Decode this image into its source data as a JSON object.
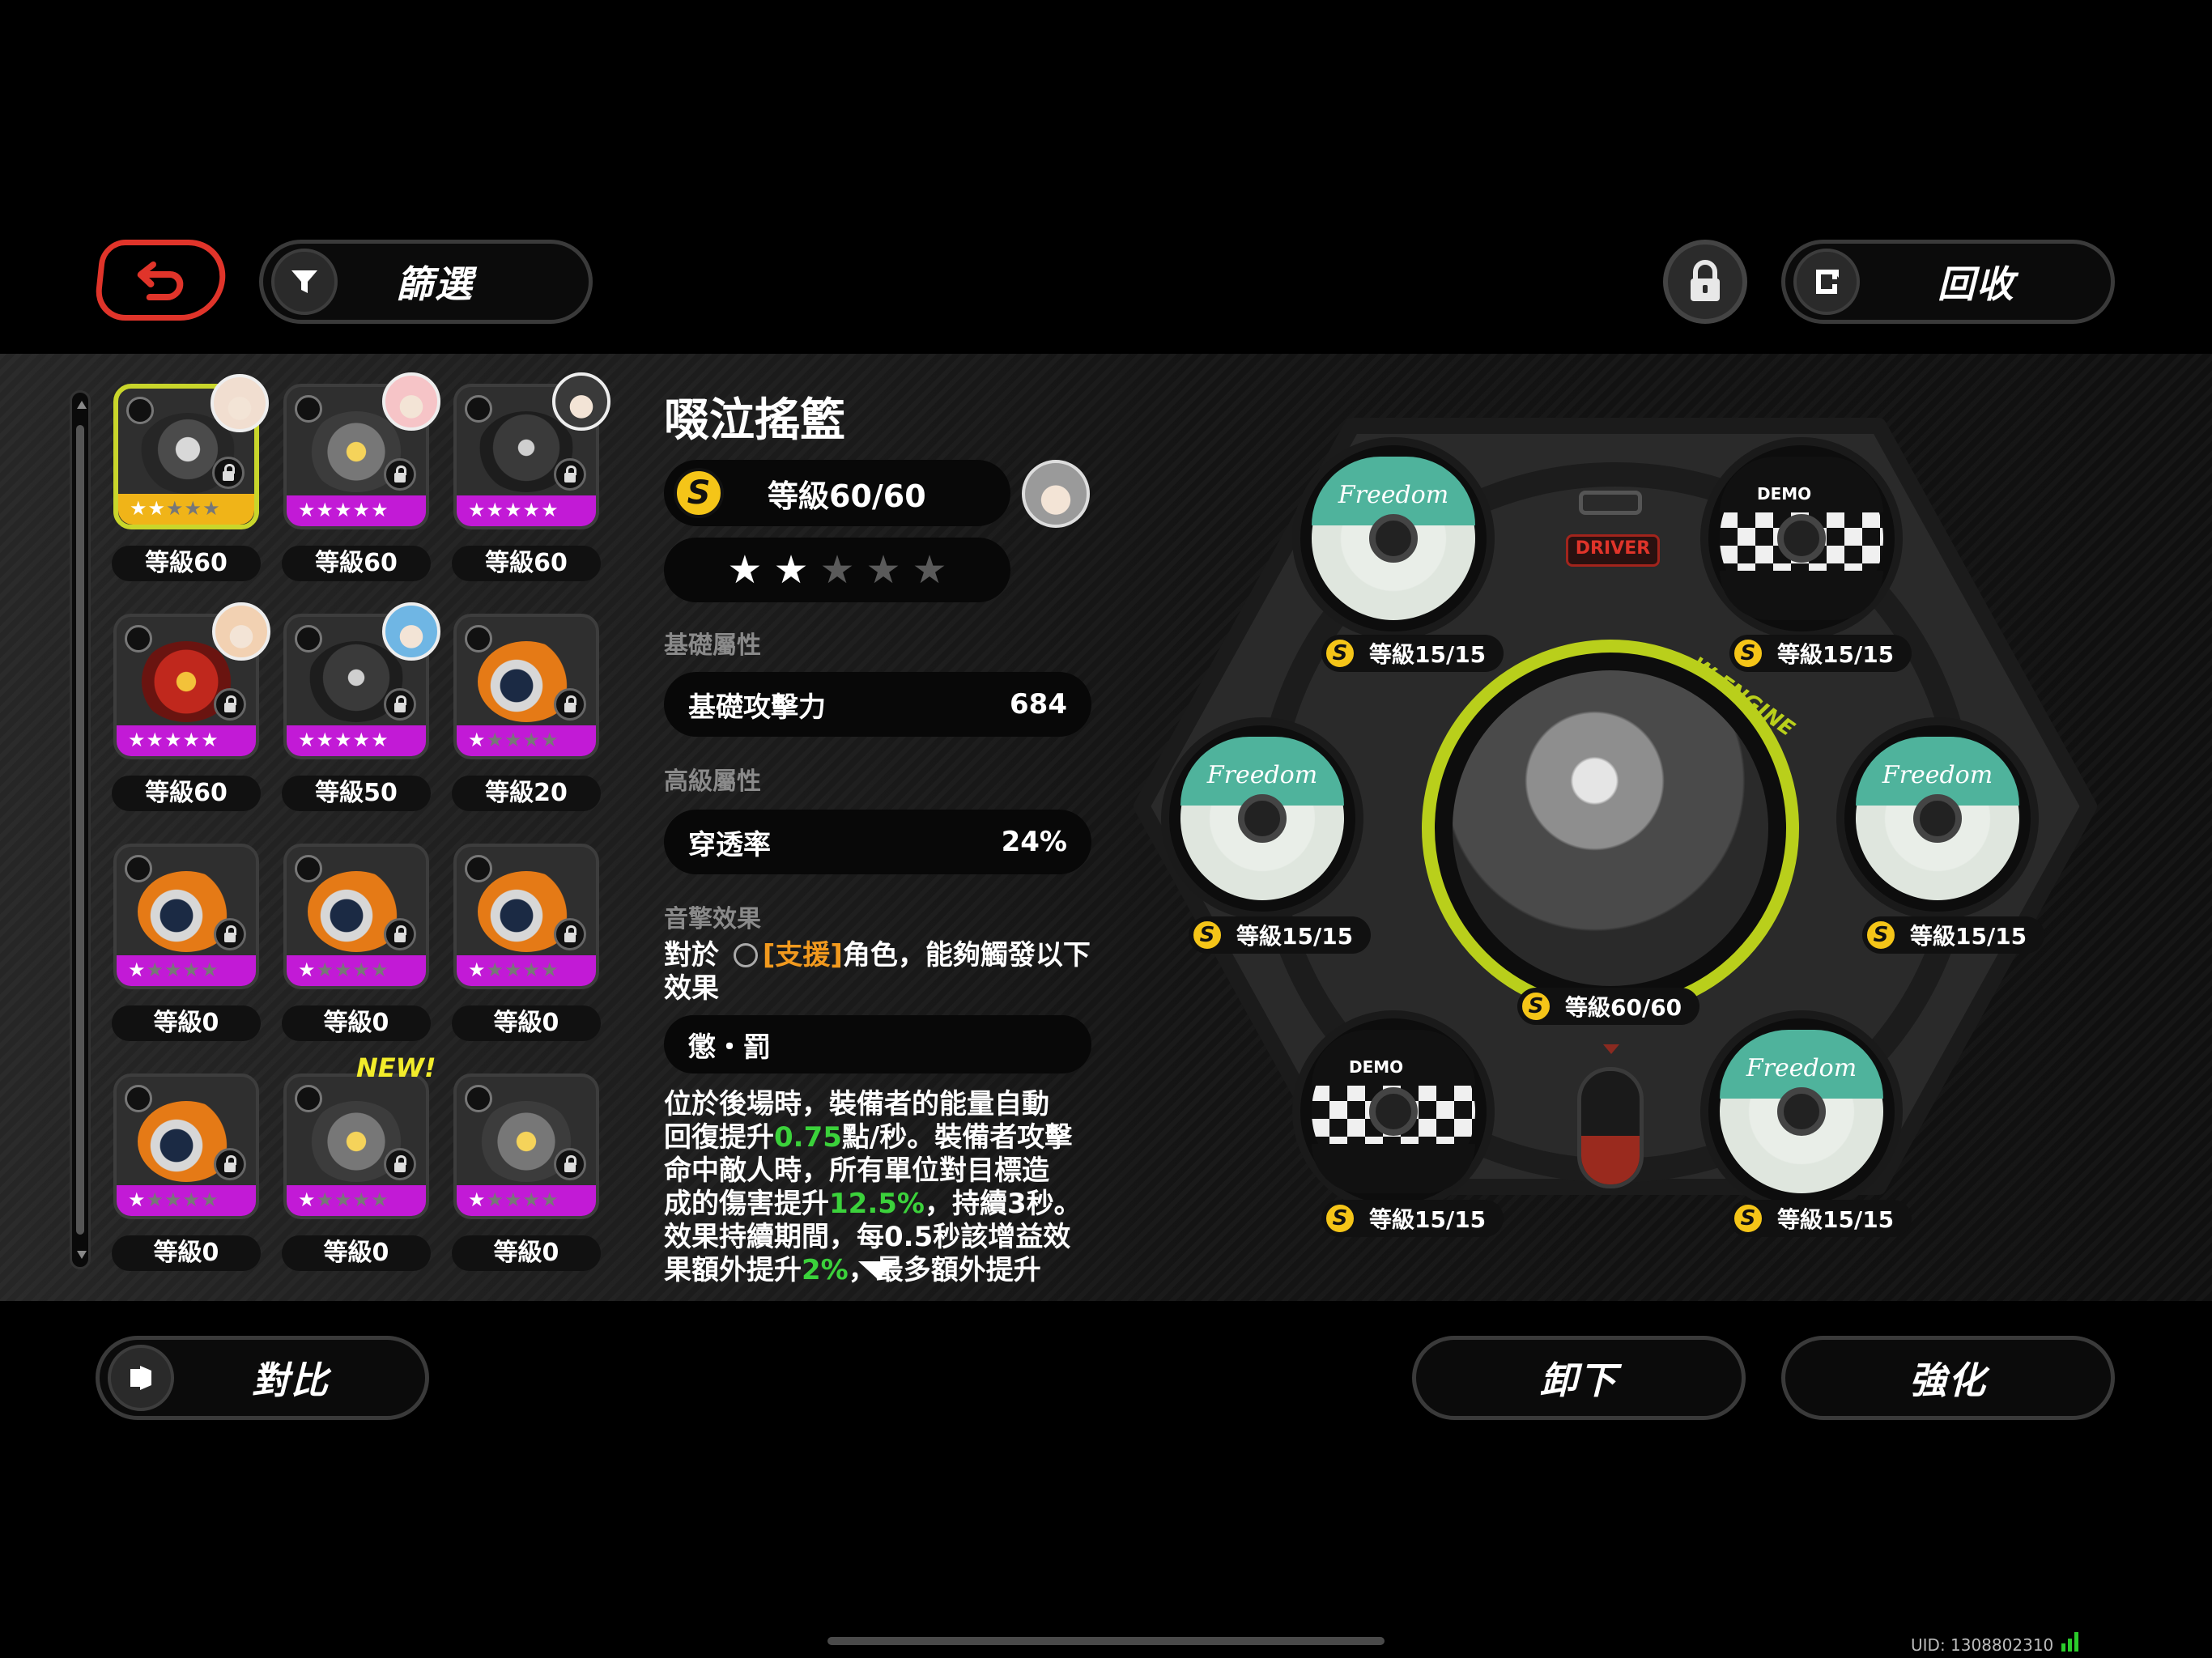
{
  "header": {
    "filter_label": "篩選",
    "recycle_label": "回收"
  },
  "footer": {
    "compare_label": "對比",
    "unequip_label": "卸下",
    "upgrade_label": "強化"
  },
  "grid": {
    "items": [
      {
        "level": "等級60",
        "stars": 2,
        "selected": true
      },
      {
        "level": "等級60",
        "stars": 5
      },
      {
        "level": "等級60",
        "stars": 5
      },
      {
        "level": "等級60",
        "stars": 5
      },
      {
        "level": "等級50",
        "stars": 5
      },
      {
        "level": "等級20",
        "stars": 1
      },
      {
        "level": "等級0",
        "stars": 1
      },
      {
        "level": "等級0",
        "stars": 1
      },
      {
        "level": "等級0",
        "stars": 1
      },
      {
        "level": "等級0",
        "stars": 1
      },
      {
        "level": "等級0",
        "stars": 1,
        "new_tag": "NEW!"
      },
      {
        "level": "等級0",
        "stars": 1
      }
    ]
  },
  "detail": {
    "name": "啜泣搖籃",
    "level": "等級60/60",
    "stars_filled": 2,
    "stars_total": 5,
    "base_section": "基礎屬性",
    "base_stat_name": "基礎攻擊力",
    "base_stat_value": "684",
    "adv_section": "高級屬性",
    "adv_stat_name": "穿透率",
    "adv_stat_value": "24%",
    "effect_section": "音擎效果",
    "effect_prefix": "對於",
    "effect_role": "[支援]",
    "effect_suffix": "角色，能夠觸發以下效果",
    "effect_title": "懲・罰",
    "effect_lines": [
      [
        "位於後場時，裝備者的能量自動",
        ""
      ],
      [
        "回復提升",
        "0.75",
        "點/秒。裝備者攻擊"
      ],
      [
        "命中敵人時，所有單位對目標造",
        ""
      ],
      [
        "成的傷害提升",
        "12.5%",
        "，持續3秒。"
      ],
      [
        "效果持續期間，每0.5秒該增益效",
        ""
      ],
      [
        "果額外提升",
        "2%",
        "，最多額外提升"
      ]
    ]
  },
  "equipment": {
    "driver_label": "DRIVER",
    "engine_label": "W-ENGINE",
    "engine_level": "等級60/60",
    "discs": [
      {
        "type": "freedom",
        "title": "Freedom",
        "level": "等級15/15"
      },
      {
        "type": "demo",
        "title": "DEMO",
        "level": "等級15/15"
      },
      {
        "type": "freedom",
        "title": "Freedom",
        "level": "等級15/15"
      },
      {
        "type": "freedom",
        "title": "Freedom",
        "level": "等級15/15"
      },
      {
        "type": "demo",
        "title": "DEMO",
        "level": "等級15/15"
      },
      {
        "type": "freedom",
        "title": "Freedom",
        "level": "等級15/15"
      }
    ]
  },
  "status": {
    "uid": "UID:  1308802310"
  },
  "colors": {
    "select_border": "#c9d62b",
    "rank_s": "#f5c518",
    "magenta": "#c21ad6",
    "accent_red": "#e0342a",
    "engine_ring": "#b9cf1b",
    "stat_green": "#3bd23b",
    "role_orange": "#f29a1e"
  }
}
